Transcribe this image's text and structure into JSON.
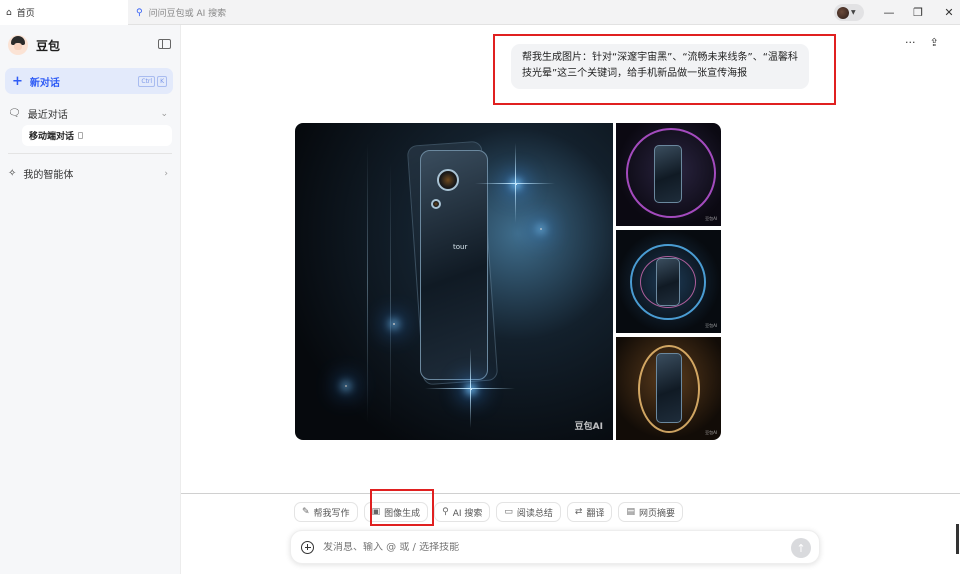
{
  "titlebar": {
    "home_tab": "首页",
    "search_placeholder": "问问豆包或 AI 搜索"
  },
  "sidebar": {
    "brand": "豆包",
    "new_chat": "新对话",
    "new_chat_shortcut": [
      "Ctrl",
      "K"
    ],
    "recent_label": "最近对话",
    "current_conversation": "移动端对话",
    "agents_label": "我的智能体"
  },
  "main": {
    "user_prompt": "帮我生成图片：针对“深邃宇宙黑”、“流畅未来线条”、“温馨科技光晕”这三个关键词，给手机新品做一张宣传海报",
    "watermark": "豆包AI",
    "phone_brand": "tour"
  },
  "skills": [
    {
      "icon": "pen-icon",
      "label": "帮我写作"
    },
    {
      "icon": "image-icon",
      "label": "图像生成"
    },
    {
      "icon": "search-icon",
      "label": "AI 搜索"
    },
    {
      "icon": "book-icon",
      "label": "阅读总结"
    },
    {
      "icon": "translate-icon",
      "label": "翻译"
    },
    {
      "icon": "webpage-icon",
      "label": "网页摘要"
    }
  ],
  "input": {
    "placeholder": "发消息、输入 @ 或 / 选择技能"
  }
}
